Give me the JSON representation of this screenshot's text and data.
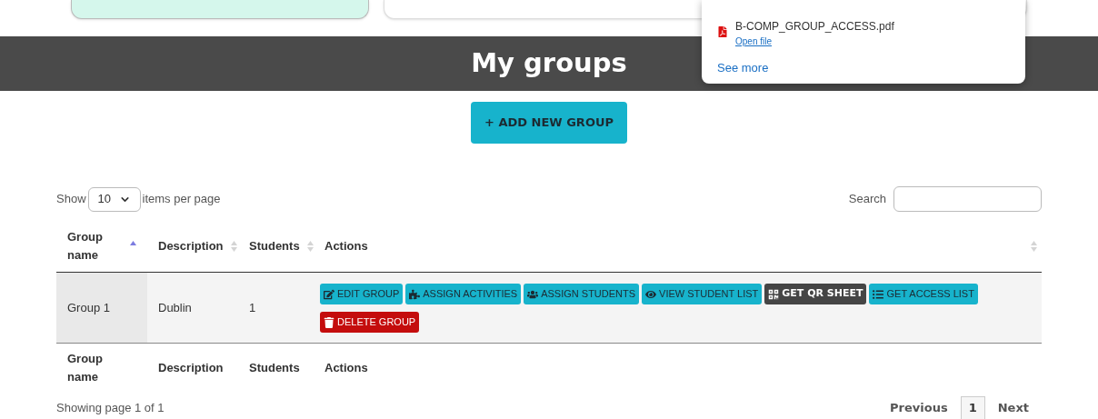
{
  "download_popup": {
    "file_name": "B-COMP_GROUP_ACCESS.pdf",
    "open_link": "Open file",
    "see_more": "See more"
  },
  "banner": {
    "title": "My groups"
  },
  "add_button": {
    "icon": "+",
    "label": "ADD NEW GROUP"
  },
  "length_control": {
    "before": "Show",
    "value": "10",
    "after": "items per page"
  },
  "search": {
    "label": "Search"
  },
  "table": {
    "columns": [
      {
        "label": "Group name",
        "sorted": true
      },
      {
        "label": "Description",
        "sorted": false
      },
      {
        "label": "Students",
        "sorted": false
      },
      {
        "label": "Actions",
        "sorted": false
      }
    ],
    "rows": [
      {
        "cells": [
          "Group 1",
          "Dublin",
          "1"
        ],
        "actions": [
          {
            "label": "EDIT GROUP",
            "kind": "primary"
          },
          {
            "label": "ASSIGN ACTIVITIES",
            "kind": "primary"
          },
          {
            "label": "ASSIGN STUDENTS",
            "kind": "primary"
          },
          {
            "label": "VIEW STUDENT LIST",
            "kind": "primary"
          },
          {
            "label": "GET QR SHEET",
            "kind": "dark"
          },
          {
            "label": "GET ACCESS LIST",
            "kind": "primary"
          },
          {
            "label": "DELETE GROUP",
            "kind": "danger"
          }
        ]
      }
    ],
    "footer_columns": [
      "Group name",
      "Description",
      "Students",
      "Actions"
    ]
  },
  "info": "Showing page 1 of 1",
  "pagination": [
    {
      "label": "Previous",
      "selected": false
    },
    {
      "label": "1",
      "selected": true
    },
    {
      "label": "Next",
      "selected": false
    }
  ]
}
